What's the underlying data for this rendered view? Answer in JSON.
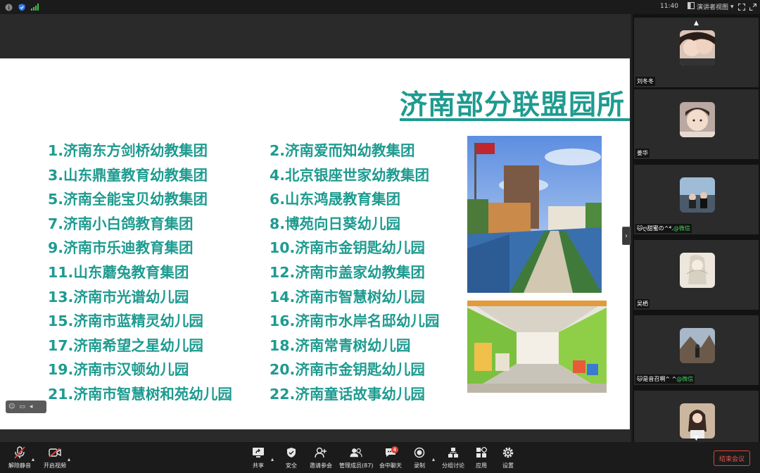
{
  "topbar": {
    "time": "11:40",
    "view_label": "演讲者视图",
    "view_caret": "▾",
    "icons": [
      "info-icon",
      "shield-icon",
      "signal-icon",
      "view-grid-icon",
      "fullscreen-icon",
      "window-expand-icon"
    ]
  },
  "slide": {
    "title": "济南部分联盟园所",
    "schools_left": [
      "1.济南东方剑桥幼教集团",
      "3.山东鼎童教育幼教集团",
      "5.济南全能宝贝幼教集团",
      "7.济南小白鸽教育集团",
      "9.济南市乐迪教育集团",
      "11.山东蘑兔教育集团",
      "13.济南市光谱幼儿园",
      "15.济南市蓝精灵幼儿园",
      "17.济南希望之星幼儿园",
      "19.济南市汉顿幼儿园",
      "21.济南市智慧树和苑幼儿园"
    ],
    "schools_right": [
      "2.济南爱而知幼教集团",
      "4.北京银座世家幼教集团",
      "6.山东鸿晟教育集团",
      "8.博苑向日葵幼儿园",
      "10.济南市金钥匙幼儿园",
      "12.济南市盖家幼教集团",
      "14.济南市智慧树幼儿园",
      "16.济南市水岸名邸幼儿园",
      "18.济南常青树幼儿园",
      "20.济南市金钥匙幼儿园",
      "22.济南童话故事幼儿园"
    ],
    "accent_color": "#1e9b90"
  },
  "participants": [
    {
      "name": "刘冬冬",
      "wechat": ""
    },
    {
      "name": "姜华",
      "wechat": ""
    },
    {
      "name": "🐱ღ甜蜜の^*.",
      "wechat": "@微信"
    },
    {
      "name": "吴栖",
      "wechat": ""
    },
    {
      "name": "🐱是音召啊^ ^",
      "wechat": "@微信"
    },
    {
      "name": "",
      "wechat": ""
    }
  ],
  "toolbar": {
    "unmute": "解除静音",
    "start_video": "开启视频",
    "share": "共享",
    "security": "安全",
    "invite": "邀请参会",
    "manage": "管理成员(87)",
    "chat": "会中聊天",
    "chat_badge": "4",
    "record": "录制",
    "breakout": "分组讨论",
    "apps": "应用",
    "settings": "设置",
    "end": "结束会议"
  }
}
